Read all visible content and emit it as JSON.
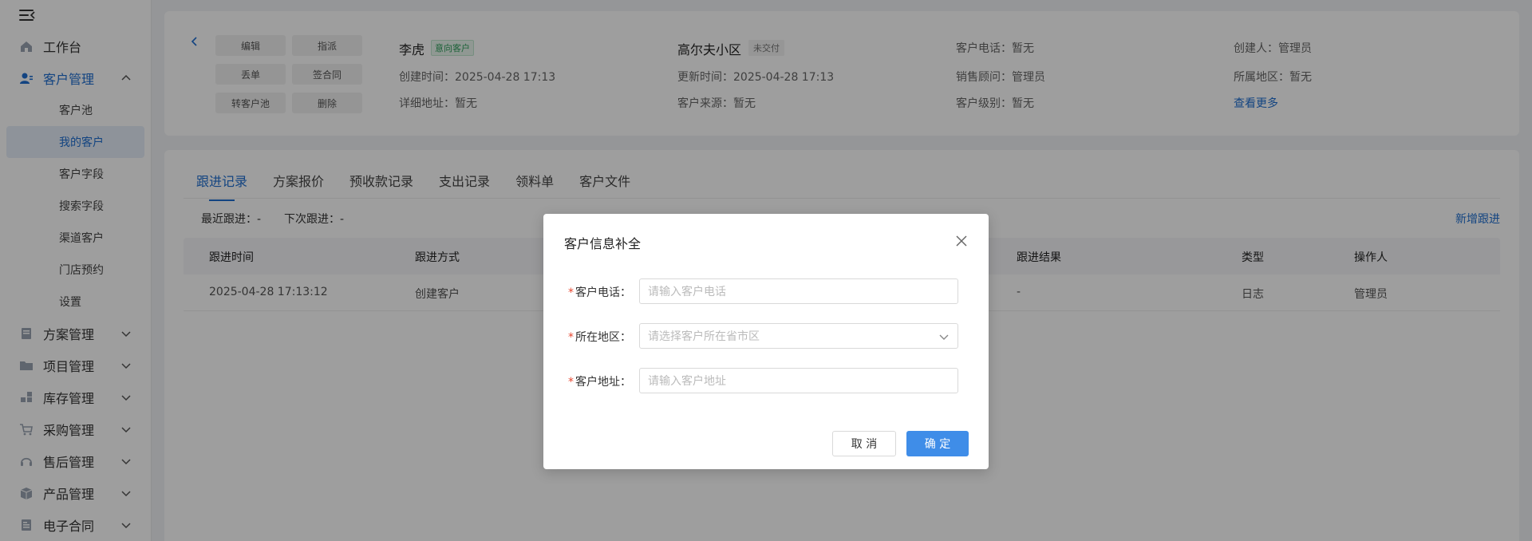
{
  "sidebar": {
    "menu": [
      {
        "label": "工作台",
        "icon": "home-icon"
      },
      {
        "label": "客户管理",
        "icon": "customer-icon",
        "active": true,
        "expanded": true
      },
      {
        "label": "方案管理",
        "icon": "plan-icon"
      },
      {
        "label": "项目管理",
        "icon": "folder-icon"
      },
      {
        "label": "库存管理",
        "icon": "inventory-icon"
      },
      {
        "label": "采购管理",
        "icon": "cart-icon"
      },
      {
        "label": "售后管理",
        "icon": "headset-icon"
      },
      {
        "label": "产品管理",
        "icon": "box-icon"
      },
      {
        "label": "电子合同",
        "icon": "contract-icon"
      }
    ],
    "submenu": [
      "客户池",
      "我的客户",
      "客户字段",
      "搜索字段",
      "渠道客户",
      "门店预约",
      "设置"
    ],
    "selected_sub": "我的客户"
  },
  "info": {
    "actions": [
      "编辑",
      "指派",
      "丢单",
      "签合同",
      "转客户池",
      "删除"
    ],
    "name": "李虎",
    "name_tag": "意向客户",
    "created": "创建时间：2025-04-28 17:13",
    "address": "详细地址：暂无",
    "community": "高尔夫小区",
    "community_tag": "未交付",
    "updated": "更新时间：2025-04-28 17:13",
    "source": "客户来源：暂无",
    "phone": "客户电话：暂无",
    "consultant": "销售顾问：管理员",
    "level": "客户级别：暂无",
    "creator": "创建人：管理员",
    "region": "所属地区：暂无",
    "more": "查看更多"
  },
  "tabs": [
    "跟进记录",
    "方案报价",
    "预收款记录",
    "支出记录",
    "领料单",
    "客户文件"
  ],
  "follow": {
    "last": "最近跟进：-",
    "next": "下次跟进：-",
    "add": "新增跟进"
  },
  "table": {
    "headers": [
      "跟进时间",
      "跟进方式",
      "跟进结果",
      "类型",
      "操作人"
    ],
    "rows": [
      {
        "time": "2025-04-28 17:13:12",
        "method": "创建客户",
        "result": "-",
        "type": "日志",
        "operator": "管理员"
      }
    ]
  },
  "modal": {
    "title": "客户信息补全",
    "fields": [
      {
        "required": "*",
        "label": "客户电话：",
        "placeholder": "请输入客户电话"
      },
      {
        "required": "*",
        "label": "所在地区：",
        "placeholder": "请选择客户所在省市区"
      },
      {
        "required": "*",
        "label": "客户地址：",
        "placeholder": "请输入客户地址"
      }
    ],
    "cancel": "取 消",
    "ok": "确 定"
  },
  "colors": {
    "accent": "#1f6fd1",
    "primary_button": "#3f8de8",
    "required": "#e6462f"
  }
}
